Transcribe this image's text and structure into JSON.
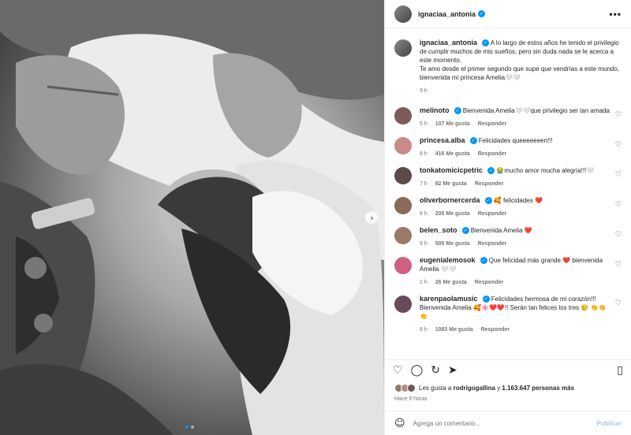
{
  "post": {
    "username": "ignaciaa_antonia",
    "more_label": "•••"
  },
  "caption": {
    "username": "ignaciaa_antonia",
    "text": "A lo largo de estos años he tenido el privilegio de cumplir muchos de mis sueños, pero sin duda nada se le acerca a este momento.",
    "text2": "Te amo desde el primer segundo que supe que vendrías a este mundo, bienvenida mi princesa Amelia🤍🤍",
    "time": "9 h"
  },
  "comments": [
    {
      "username": "melinoto",
      "text": "Bienvenida Amelia🤍🤍que privilegio ser tan amada",
      "time": "5 h",
      "likes": "107 Me gusta",
      "reply": "Responder"
    },
    {
      "username": "princesa.alba",
      "text": "Felicidades queeeeeeen!!!",
      "time": "8 h",
      "likes": "416 Me gusta",
      "reply": "Responder"
    },
    {
      "username": "tonkatomicicpetric",
      "text": "😭mucho amor mucha alegría!!!🤍",
      "time": "7 h",
      "likes": "82 Me gusta",
      "reply": "Responder"
    },
    {
      "username": "oliverbornercerda",
      "text": "🥰 felicidades ❤️",
      "time": "8 h",
      "likes": "200 Me gusta",
      "reply": "Responder"
    },
    {
      "username": "belen_soto",
      "text": "Bienvenida Amelia ❤️",
      "time": "9 h",
      "likes": "505 Me gusta",
      "reply": "Responder"
    },
    {
      "username": "eugenialemosok",
      "text": "Que felicidad más grande ❤️ bienvenida Amelia 🤍🤍",
      "time": "1 h",
      "likes": "26 Me gusta",
      "reply": "Responder"
    },
    {
      "username": "karenpaolamusic",
      "text": "Felicidades hermosa de mi corazón!!! Bienvenida Amelia 🥰🌸❤️❤️!! Serán tan felices los tres 🥲 👏👏👏",
      "time": "8 h",
      "likes": "1083 Me gusta",
      "reply": "Responder"
    }
  ],
  "likes_line": {
    "prefix": "Les gusta a",
    "user": "rodrigogallina",
    "connector": "y",
    "count": "1.163.647 personas más"
  },
  "time_ago": "Hace 9 horas",
  "add_comment": {
    "placeholder": "Agrega un comentario...",
    "publish": "Publicar"
  },
  "icons": {
    "heart": "heart-icon",
    "comment": "comment-icon",
    "share": "share-icon",
    "save": "bookmark-icon",
    "emoji": "emoji-icon",
    "next": "chevron-right-icon"
  },
  "colors": {
    "accent": "#0095f6",
    "publish_disabled": "#9ecbf6",
    "meta_text": "#737373"
  }
}
